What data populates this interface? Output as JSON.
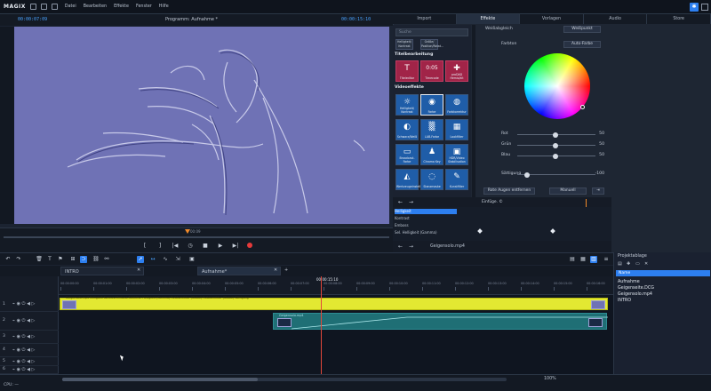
{
  "app": {
    "logo": "MAGIX",
    "menu": [
      "Datei",
      "Bearbeiten",
      "Effekte",
      "Fenster",
      "Hilfe"
    ]
  },
  "preview": {
    "timecode_left": "00:00:07:09",
    "title": "Programm: Aufnahme *",
    "timecode_right": "00:00:15:10",
    "scrub_marker_time": "00:09",
    "transport": [
      "[",
      "]",
      "|◀",
      "◷",
      "■",
      "▶",
      "▶|",
      "rec"
    ]
  },
  "right_panel": {
    "tabs": [
      "Import",
      "Effekte",
      "Vorlagen",
      "Audio",
      "Store"
    ],
    "active_tab": "Effekte",
    "search_placeholder": "Suche",
    "chips": [
      "Helligkeit/ Kontrast",
      "Größe/ Position/Rotat..."
    ],
    "section_titelbearbeitung": "Titelbearbeitung",
    "title_tiles": [
      {
        "label": "Titeleditor",
        "glyph": "T"
      },
      {
        "label": "Timecode",
        "glyph": "0:05"
      },
      {
        "label": "proDAD Hemis/kit",
        "glyph": "✚"
      }
    ],
    "section_videoeffekte": "Videoeffekte",
    "video_tiles": [
      {
        "label": "Helligkeit/ Kontrast",
        "glyph": "☼"
      },
      {
        "label": "Farbe",
        "glyph": "◉"
      },
      {
        "label": "Farbkorrektur",
        "glyph": "◍"
      },
      {
        "label": "Schwarz/Weiß",
        "glyph": "◐"
      },
      {
        "label": "LAB-Farbe",
        "glyph": "▒"
      },
      {
        "label": "Lookfilter",
        "glyph": "▦"
      },
      {
        "label": "Broadcast-Farbe",
        "glyph": "▭"
      },
      {
        "label": "Chroma Key",
        "glyph": "♟"
      },
      {
        "label": "HDR/Video Stabilisation",
        "glyph": "▣"
      },
      {
        "label": "Werkzeugeinstell.",
        "glyph": "◭"
      },
      {
        "label": "Stanzmaske",
        "glyph": "◌"
      },
      {
        "label": "Kunstfilter",
        "glyph": "✎"
      }
    ]
  },
  "color_panel": {
    "weissabgleich": "Weißabgleich",
    "weisspunkt_btn": "Weißpunkt",
    "farbton": "Farbton",
    "auto_farbe_btn": "Auto-Farbe",
    "rot": {
      "label": "Rot",
      "value": 50
    },
    "gruen": {
      "label": "Grün",
      "value": 50
    },
    "blau": {
      "label": "Blau",
      "value": 50
    },
    "saettigung": {
      "label": "Sättigung",
      "value": -100
    },
    "rote_augen_btn": "Rote Augen entfernen",
    "manuell_btn": "Manuell"
  },
  "keyframes": {
    "head_label": "Einfüge. ©",
    "rows": [
      "Helligkeit",
      "Kontrast",
      "Emboss",
      "Sel. Helligkeit (Gamma)"
    ],
    "foot_file": "Geigensolo.mp4"
  },
  "project_tabs": [
    {
      "label": "INTRO"
    },
    {
      "label": "Aufnahme*"
    }
  ],
  "ruler": {
    "current": "00:00:15:10",
    "labels": [
      "00:00:00:00",
      "00:00:01:00",
      "00:00:02:00",
      "00:00:03:00",
      "00:00:04:00",
      "00:00:05:00",
      "00:00:06:00",
      "00:00:07:00",
      "00:00:08:00",
      "00:00:09:00",
      "00:00:10:00",
      "00:00:11:00",
      "00:00:12:00",
      "00:00:13:00",
      "00:00:14:00",
      "00:00:15:00",
      "00:00:16:00"
    ]
  },
  "tracks": {
    "track_numbers": [
      "1",
      "2",
      "3",
      "4",
      "5",
      "6"
    ],
    "yellow_clip_text": "Geigensolo.mp4  Helligkeit  Kontrast  Emboss  Selektive Helligkeit (Gamma)  Farbkorrektur (Global)  Farbkorrektur (Global)  Sättigung",
    "teal_clip_text": "Geigensolo.mp4"
  },
  "project_bin": {
    "title": "Projektablage",
    "header": "Name",
    "items": [
      "Aufnahme",
      "Geigenseite.DCG",
      "Geigensolo.mp4",
      "INTRO"
    ]
  },
  "status": {
    "zoom": "100%",
    "cpu": "CPU: —"
  },
  "colors": {
    "accent": "#2d7ff0",
    "clip_yellow": "#e3e832",
    "clip_teal": "#1f6f75",
    "playhead": "#e2473a",
    "video_tint": "#6f72b5"
  }
}
